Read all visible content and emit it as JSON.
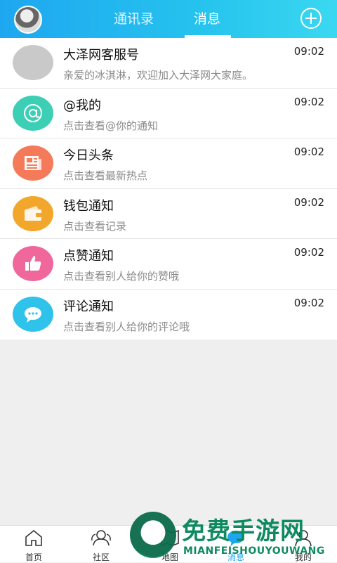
{
  "header": {
    "tabs": [
      {
        "label": "通讯录",
        "active": false
      },
      {
        "label": "消息",
        "active": true
      }
    ],
    "accent": "#1ea7f0"
  },
  "messages": [
    {
      "title": "大泽网客服号",
      "subtitle": "亲爱的冰淇淋，欢迎加入大泽网大家庭。",
      "time": "09:02",
      "icon": "avatar-gray",
      "color": "#c9c9c9"
    },
    {
      "title": "@我的",
      "subtitle": "点击查看@你的通知",
      "time": "09:02",
      "icon": "at-icon",
      "color": "#3ccfb6"
    },
    {
      "title": "今日头条",
      "subtitle": "点击查看最新热点",
      "time": "09:02",
      "icon": "newspaper-icon",
      "color": "#f47a5a"
    },
    {
      "title": "钱包通知",
      "subtitle": "点击查看记录",
      "time": "09:02",
      "icon": "wallet-icon",
      "color": "#f2a72c"
    },
    {
      "title": "点赞通知",
      "subtitle": "点击查看别人给你的赞哦",
      "time": "09:02",
      "icon": "thumbs-up-icon",
      "color": "#f0679b"
    },
    {
      "title": "评论通知",
      "subtitle": "点击查看别人给你的评论哦",
      "time": "09:02",
      "icon": "comment-icon",
      "color": "#2fc2ea"
    }
  ],
  "bottom_nav": [
    {
      "label": "首页",
      "icon": "home-icon",
      "active": false
    },
    {
      "label": "社区",
      "icon": "community-icon",
      "active": false
    },
    {
      "label": "地图",
      "icon": "map-icon",
      "active": false
    },
    {
      "label": "消息",
      "icon": "message-icon",
      "active": true
    },
    {
      "label": "我的",
      "icon": "profile-icon",
      "active": false
    }
  ],
  "watermark": {
    "title": "免费手游网",
    "subtitle": "MIANFEISHOUYOUWANG"
  }
}
